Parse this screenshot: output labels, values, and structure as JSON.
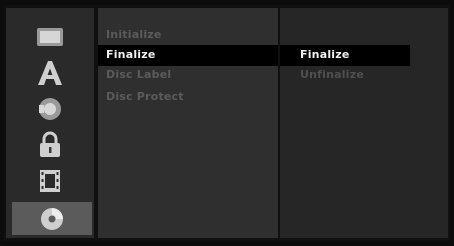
{
  "sidebar": {
    "items": [
      {
        "icon": "tv-screen-icon"
      },
      {
        "icon": "language-icon"
      },
      {
        "icon": "speaker-icon"
      },
      {
        "icon": "lock-icon"
      },
      {
        "icon": "film-icon"
      },
      {
        "icon": "disc-icon",
        "selected": true
      }
    ]
  },
  "menu": {
    "items": [
      {
        "label": "Initialize"
      },
      {
        "label": "Finalize",
        "selected": true
      },
      {
        "label": "Disc Label"
      },
      {
        "label": "Disc Protect"
      }
    ]
  },
  "submenu": {
    "items": [
      {
        "label": "Finalize",
        "selected": true
      },
      {
        "label": "Unfinalize"
      }
    ]
  },
  "colors": {
    "selected_text": "#f1f1f1",
    "dim_text": "#5b5b5b",
    "selected_bg": "#000000",
    "active_tab_bg": "#5b5b5b"
  }
}
